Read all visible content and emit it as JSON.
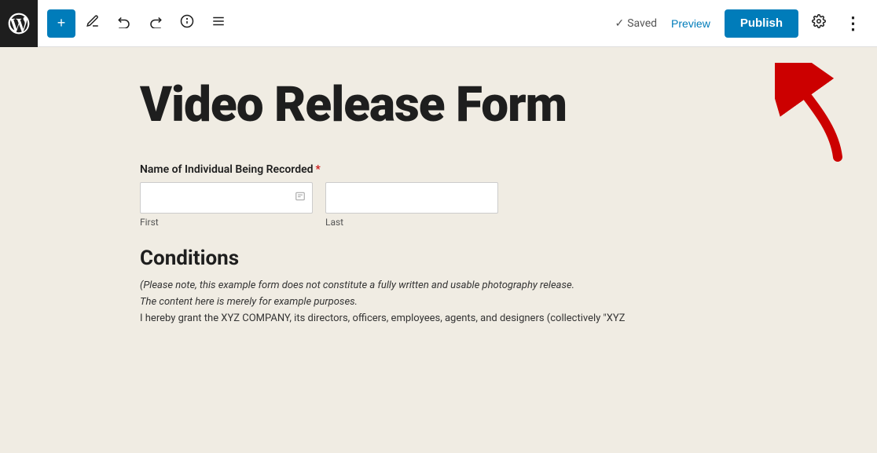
{
  "toolbar": {
    "wp_logo_label": "WordPress",
    "add_button_label": "+",
    "tools_icon": "✏",
    "undo_icon": "↩",
    "redo_icon": "↪",
    "info_icon": "ⓘ",
    "list_view_icon": "≡",
    "saved_label": "Saved",
    "preview_label": "Preview",
    "publish_label": "Publish",
    "settings_icon": "⚙",
    "more_icon": "⋮"
  },
  "page": {
    "title": "Video Release Form",
    "form": {
      "name_label": "Name of Individual Being Recorded",
      "required_star": "*",
      "first_placeholder": "",
      "last_placeholder": "",
      "first_sub_label": "First",
      "last_sub_label": "Last"
    },
    "conditions": {
      "heading": "Conditions",
      "text_line1": "(Please note, this example form does not constitute a fully written and usable photography release.",
      "text_line2": "The content here is merely for example purposes.",
      "text_line3": "I hereby grant the XYZ COMPANY, its directors, officers, employees, agents, and designers (collectively \"XYZ"
    }
  }
}
